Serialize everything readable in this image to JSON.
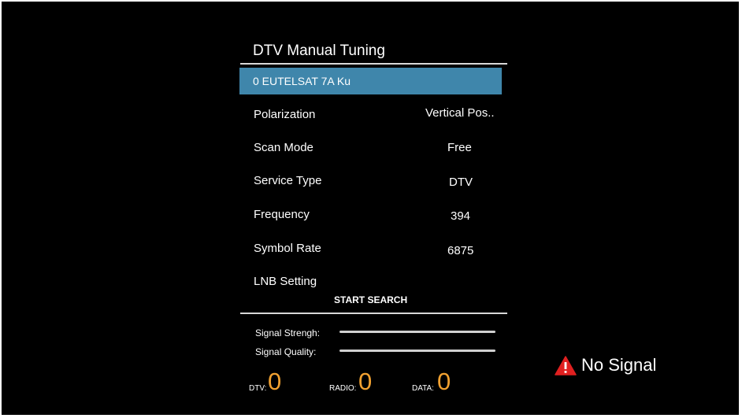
{
  "menu": {
    "title": "DTV Manual Tuning",
    "satellite": "0 EUTELSAT 7A Ku",
    "rows": [
      {
        "label": "Polarization",
        "value": "Vertical Pos.."
      },
      {
        "label": "Scan Mode",
        "value": "Free"
      },
      {
        "label": "Service Type",
        "value": "DTV"
      },
      {
        "label": "Frequency",
        "value": "394"
      },
      {
        "label": "Symbol Rate",
        "value": "6875"
      },
      {
        "label": "LNB Setting",
        "value": ""
      }
    ],
    "start_search": "START SEARCH"
  },
  "signal": {
    "strength_label": "Signal Strengh:",
    "quality_label": "Signal Quality:"
  },
  "counts": {
    "dtv_label": "DTV:",
    "dtv_value": "0",
    "radio_label": "RADIO:",
    "radio_value": "0",
    "data_label": "DATA:",
    "data_value": "0"
  },
  "status": {
    "icon": "warning-icon",
    "text": "No Signal",
    "icon_color": "#e02020"
  },
  "colors": {
    "background": "#000000",
    "highlight": "#3f86ab",
    "count_accent": "#f0a030"
  }
}
